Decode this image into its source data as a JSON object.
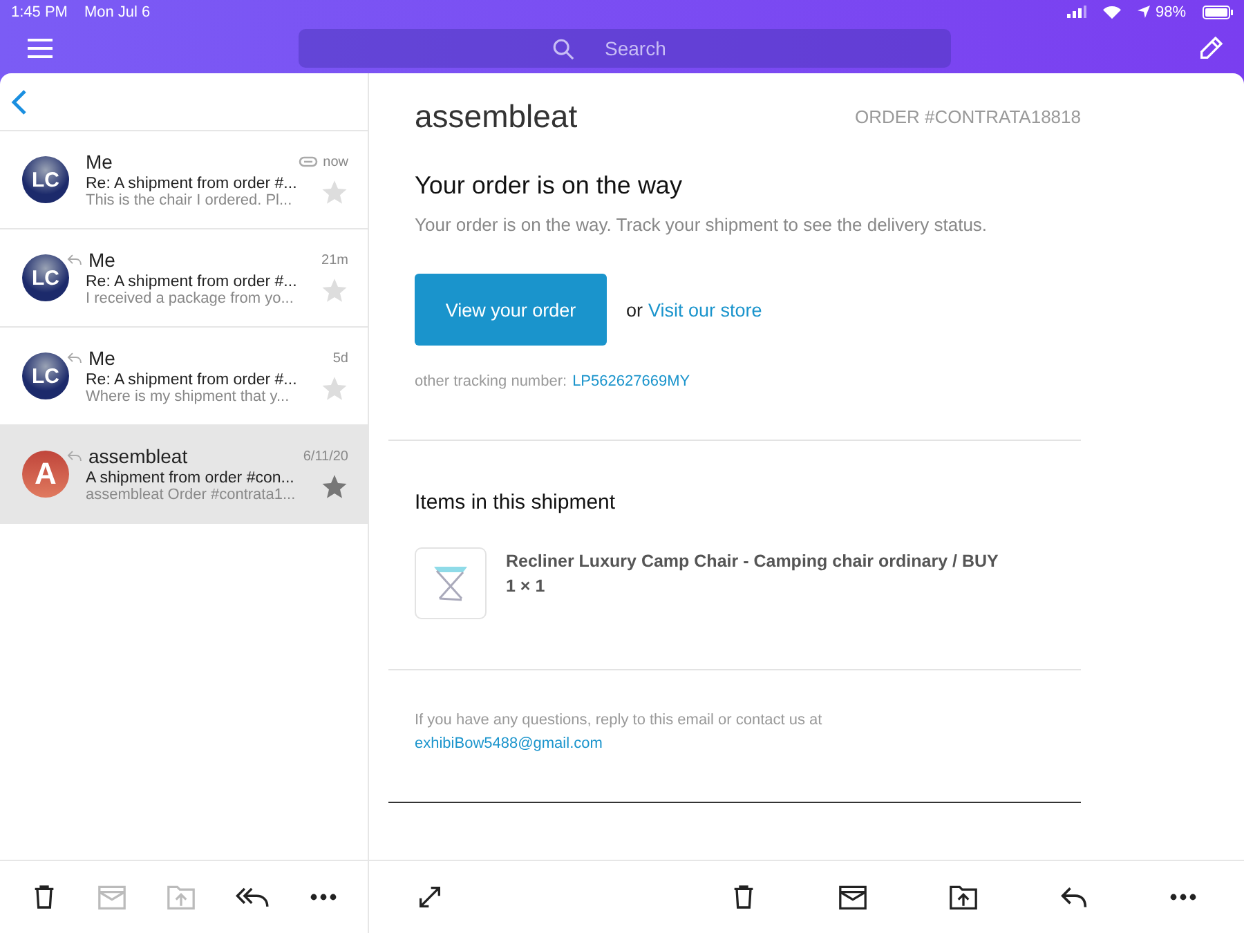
{
  "status_bar": {
    "time": "1:45 PM",
    "date": "Mon Jul 6",
    "battery": "98%"
  },
  "header": {
    "search": {
      "placeholder": "Search"
    }
  },
  "messages": [
    {
      "sender": "Me",
      "time": "now",
      "subject": "Re: A shipment from order #...",
      "preview": "This is the chair I ordered. Pl...",
      "avatar": "LC",
      "replied": false,
      "attachment": true,
      "starred": false,
      "selected": false
    },
    {
      "sender": "Me",
      "time": "21m",
      "subject": "Re: A shipment from order #...",
      "preview": "I received a package from yo...",
      "avatar": "LC",
      "replied": true,
      "attachment": false,
      "starred": false,
      "selected": false
    },
    {
      "sender": "Me",
      "time": "5d",
      "subject": "Re: A shipment from order #...",
      "preview": "Where is my shipment that y...",
      "avatar": "LC",
      "replied": true,
      "attachment": false,
      "starred": false,
      "selected": false
    },
    {
      "sender": "assembleat",
      "time": "6/11/20",
      "subject": "A shipment from order #con...",
      "preview": "assembleat Order #contrata1...",
      "avatar": "A",
      "replied": true,
      "attachment": false,
      "starred": true,
      "selected": true
    }
  ],
  "email": {
    "brand": "assembleat",
    "order_number": "ORDER #CONTRATA18818",
    "heading": "Your order is on the way",
    "intro": "Your order is on the way. Track your shipment to see the delivery status.",
    "button": "View your order",
    "or_text": "or",
    "store_link": "Visit our store",
    "tracking_label": "other tracking number:",
    "tracking_number": "LP562627669MY",
    "items_heading": "Items in this shipment",
    "items": [
      {
        "title": "Recliner Luxury Camp Chair - Camping chair ordinary / BUY",
        "quantity": "1 × 1"
      }
    ],
    "footer_text": "If you have any questions, reply to this email or contact us at",
    "footer_email": "exhibiBow5488@gmail.com"
  },
  "list_toolbar": [
    {
      "kind": "trash",
      "disabled": false
    },
    {
      "kind": "archive",
      "disabled": true
    },
    {
      "kind": "move",
      "disabled": true
    },
    {
      "kind": "reply-all",
      "disabled": false
    },
    {
      "kind": "more",
      "disabled": false
    }
  ],
  "reader_toolbar": [
    {
      "kind": "expand",
      "disabled": false
    },
    {
      "kind": "trash",
      "disabled": false
    },
    {
      "kind": "archive",
      "disabled": false
    },
    {
      "kind": "move",
      "disabled": false
    },
    {
      "kind": "reply",
      "disabled": false
    },
    {
      "kind": "more",
      "disabled": false
    }
  ]
}
